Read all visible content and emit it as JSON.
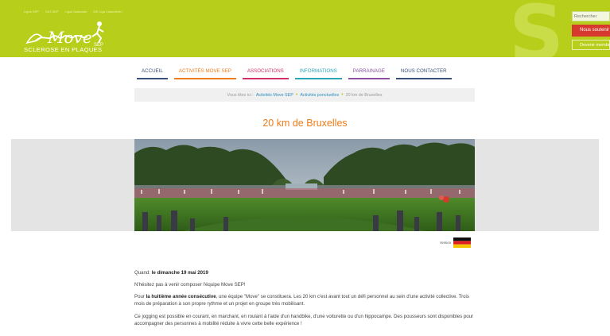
{
  "header": {
    "top_links": [
      "Ligue SEP",
      "SAT-SEP",
      "Ligue Nationale",
      "MS Liga Vlaanderen"
    ],
    "logo_alt": "Move SEP",
    "tagline": "SCLEROSE EN PLAQUES",
    "search_placeholder": "Rechercher",
    "support_button": "Nous soutenir",
    "member_button": "Devenir membre"
  },
  "nav": {
    "items": [
      {
        "label": "ACCUEIL",
        "color": "#3a4f7a"
      },
      {
        "label": "ACTIVITÉS MOVE SEP",
        "color": "#ef7c1a"
      },
      {
        "label": "ASSOCIATIONS",
        "color": "#d6306b"
      },
      {
        "label": "INFORMATIONS",
        "color": "#2aa6b7"
      },
      {
        "label": "PARRAINAGE",
        "color": "#8a4fa1"
      },
      {
        "label": "NOUS CONTACTER",
        "color": "#3a4f7a"
      }
    ]
  },
  "breadcrumb": {
    "prefix": "Vous êtes ici :",
    "crumbs": [
      "Activités Move SEP",
      "Activités ponctuelles",
      "20 km de Bruxelles"
    ]
  },
  "page": {
    "title": "20 km de Bruxelles",
    "version_label": "Version"
  },
  "content": {
    "when_label": "Quand:",
    "when_value": "le dimanche 19 mai 2019",
    "p1": "N'hésitez pas à venir composer l'équipe Move SEP!",
    "p2_a": "Pour ",
    "p2_bold": "la huitième année consécutive",
    "p2_b": ", une équipe \"Move\" se constituera. Les 20 km c'est avant tout un défi personnel au sein d'une activité collective. Trois mois de préparation à son propre rythme et un projet en groupe très mobilisant.",
    "p3": "Ce jogging est possible en courant, en marchant, en roulant à l'aide d'un handbike, d'une voiturette ou d'un hippocampe. Des pousseurs sont disponibles pour accompagner des personnes à mobilité réduite à vivre cette belle expérience !"
  },
  "colors": {
    "brand_green": "#b7cf1a",
    "title_orange": "#ef7c1a",
    "link_blue": "#2a8fbd",
    "button_red": "#d63a2e"
  }
}
